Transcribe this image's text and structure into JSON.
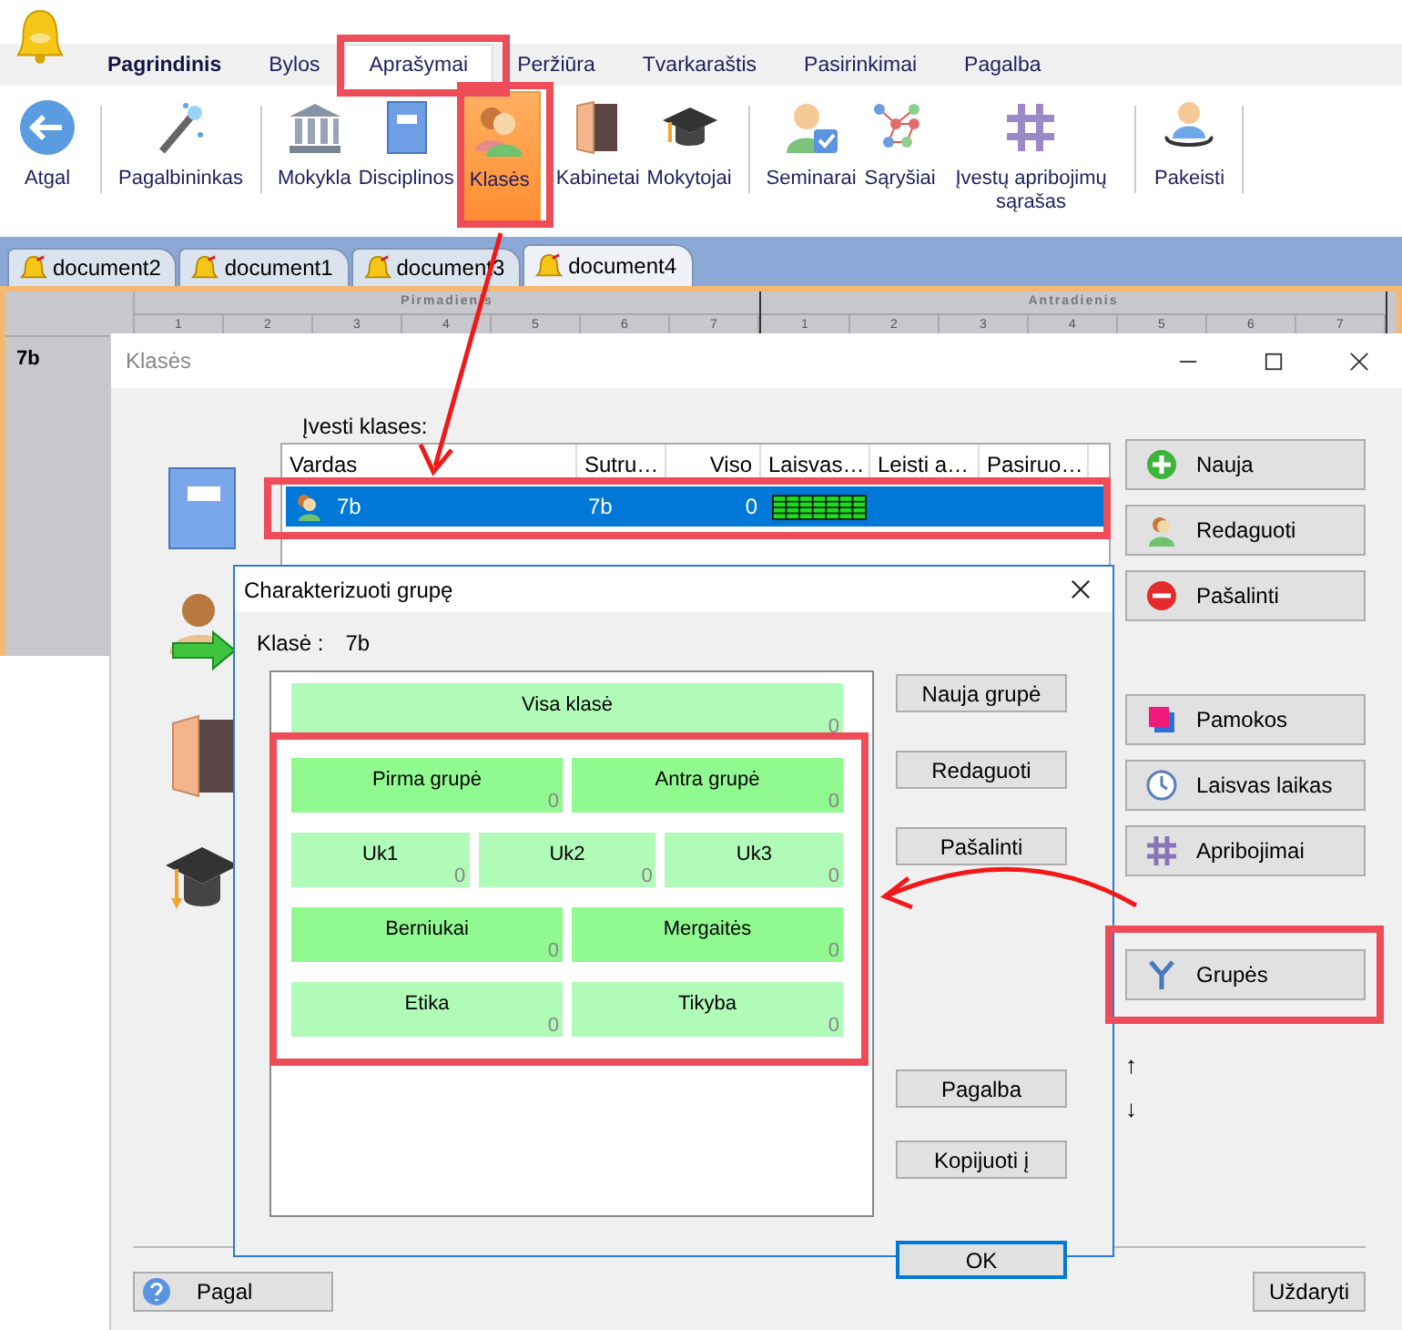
{
  "menu_tabs": [
    {
      "label": "Pagrindinis",
      "emphasized": true,
      "selected": false
    },
    {
      "label": "Bylos",
      "emphasized": false,
      "selected": false
    },
    {
      "label": "Aprašymai",
      "emphasized": false,
      "selected": true
    },
    {
      "label": "Peržiūra",
      "emphasized": false,
      "selected": false
    },
    {
      "label": "Tvarkaraštis",
      "emphasized": false,
      "selected": false
    },
    {
      "label": "Pasirinkimai",
      "emphasized": false,
      "selected": false
    },
    {
      "label": "Pagalba",
      "emphasized": false,
      "selected": false
    }
  ],
  "ribbon": {
    "groups": [
      {
        "items": [
          {
            "label": "Atgal",
            "selected": false
          }
        ]
      },
      {
        "items": [
          {
            "label": "Pagalbininkas",
            "selected": false
          }
        ]
      },
      {
        "items": [
          {
            "label": "Mokykla",
            "selected": false
          },
          {
            "label": "Disciplinos",
            "selected": false
          },
          {
            "label": "Klasės",
            "selected": true
          },
          {
            "label": "Kabinetai",
            "selected": false
          },
          {
            "label": "Mokytojai",
            "selected": false
          }
        ]
      },
      {
        "items": [
          {
            "label": "Seminarai",
            "selected": false
          },
          {
            "label": "Sąryšiai",
            "selected": false
          },
          {
            "label": "Įvestų apribojimų sąrašas",
            "selected": false
          }
        ]
      },
      {
        "items": [
          {
            "label": "Pakeisti",
            "selected": false
          }
        ]
      }
    ]
  },
  "documents": [
    {
      "label": "document2",
      "selected": false
    },
    {
      "label": "document1",
      "selected": false
    },
    {
      "label": "document3",
      "selected": false
    },
    {
      "label": "document4",
      "selected": true
    }
  ],
  "timetable": {
    "days": [
      {
        "name": "Pirmadienis",
        "periods": [
          "1",
          "2",
          "3",
          "4",
          "5",
          "6",
          "7"
        ]
      },
      {
        "name": "Antradienis",
        "periods": [
          "1",
          "2",
          "3",
          "4",
          "5",
          "6",
          "7"
        ]
      }
    ],
    "rows": [
      "7b"
    ]
  },
  "classes_window": {
    "title": "Klasės",
    "list_label": "Įvesti klases:",
    "columns": [
      "Vardas",
      "Sutru…",
      "Viso",
      "Laisvas…",
      "Leisti a…",
      "Pasiruo…"
    ],
    "rows": [
      {
        "name": "7b",
        "short": "7b",
        "total": "0",
        "selected": true
      }
    ],
    "button_groups": [
      [
        "Nauja",
        "Redaguoti",
        "Pašalinti"
      ],
      [
        "Pamokos",
        "Laisvas laikas",
        "Apribojimai"
      ],
      [
        "Grupės"
      ]
    ],
    "move_up": "↑",
    "move_down": "↓",
    "help_button": "Pagal",
    "close_button": "Uždaryti"
  },
  "group_dialog": {
    "title": "Charakterizuoti grupę",
    "class_label": "Klasė :",
    "class_value": "7b",
    "rows": [
      {
        "tiles": [
          {
            "name": "Visa klasė",
            "count": "0",
            "color": "#b0fbb8"
          }
        ]
      },
      {
        "tiles": [
          {
            "name": "Pirma grupė",
            "count": "0",
            "color": "#90f990"
          },
          {
            "name": "Antra grupė",
            "count": "0",
            "color": "#90f990"
          }
        ]
      },
      {
        "tiles": [
          {
            "name": "Uk1",
            "count": "0",
            "color": "#b0fbb8"
          },
          {
            "name": "Uk2",
            "count": "0",
            "color": "#b0fbb8"
          },
          {
            "name": "Uk3",
            "count": "0",
            "color": "#b0fbb8"
          }
        ]
      },
      {
        "tiles": [
          {
            "name": "Berniukai",
            "count": "0",
            "color": "#90f990"
          },
          {
            "name": "Mergaitės",
            "count": "0",
            "color": "#90f990"
          }
        ]
      },
      {
        "tiles": [
          {
            "name": "Etika",
            "count": "0",
            "color": "#b0fbb8"
          },
          {
            "name": "Tikyba",
            "count": "0",
            "color": "#b0fbb8"
          }
        ]
      }
    ],
    "button_groups": [
      [
        "Nauja grupė",
        "Redaguoti",
        "Pašalinti"
      ],
      [
        "Pagalba",
        "Kopijuoti į"
      ]
    ],
    "ok_button": {
      "label": "OK",
      "focused": true
    }
  }
}
